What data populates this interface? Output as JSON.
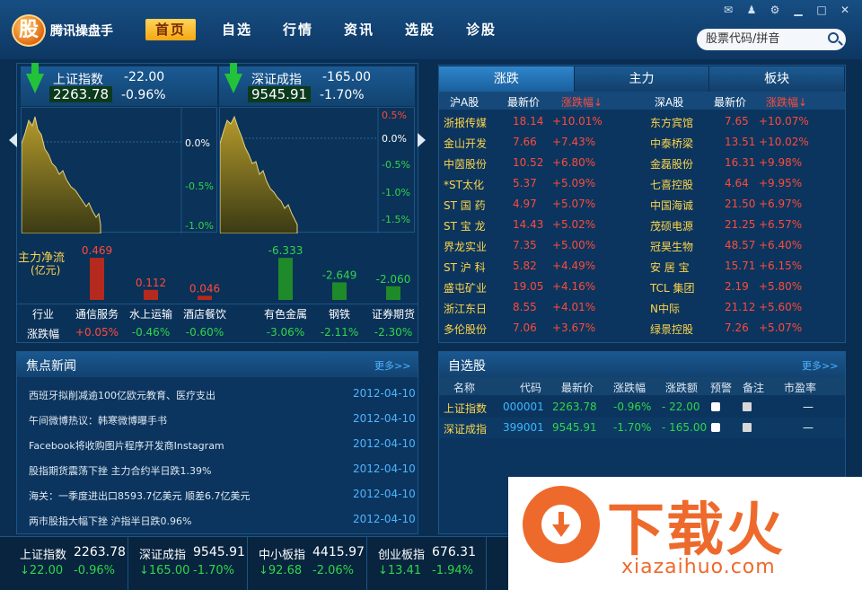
{
  "app": {
    "logo_char": "股",
    "name": "腾讯操盘手"
  },
  "nav": [
    "首页",
    "自选",
    "行情",
    "资讯",
    "选股",
    "诊股"
  ],
  "search": {
    "placeholder": "股票代码/拼音"
  },
  "indices": [
    {
      "name": "上证指数",
      "change": "-22.00",
      "value": "2263.78",
      "pct": "-0.96%",
      "axis": [
        "0.0%",
        "-0.5%",
        "-1.0%"
      ]
    },
    {
      "name": "深证成指",
      "change": "-165.00",
      "value": "9545.91",
      "pct": "-1.70%",
      "axis": [
        "0.5%",
        "0.0%",
        "-0.5%",
        "-1.0%",
        "-1.5%"
      ]
    }
  ],
  "fund_flow": {
    "title": "主力净流",
    "unit": "(亿元)",
    "row_labels": [
      "行业",
      "涨跌幅"
    ],
    "items": [
      {
        "industry": "通信服务",
        "value": "0.469",
        "change": "+0.05%",
        "amount": 0.469
      },
      {
        "industry": "水上运输",
        "value": "0.112",
        "change": "-0.46%",
        "amount": 0.112
      },
      {
        "industry": "酒店餐饮",
        "value": "0.046",
        "change": "-0.60%",
        "amount": 0.046
      },
      {
        "industry": "有色金属",
        "value": "-6.333",
        "change": "-3.06%",
        "amount": -6.333
      },
      {
        "industry": "钢铁",
        "value": "-2.649",
        "change": "-2.11%",
        "amount": -2.649
      },
      {
        "industry": "证券期货",
        "value": "-2.060",
        "change": "-2.30%",
        "amount": -2.06
      }
    ]
  },
  "rank_tabs": [
    "涨跌",
    "主力",
    "板块"
  ],
  "rank_header": {
    "sh": "沪A股",
    "price": "最新价",
    "pct": "涨跌幅↓",
    "sz": "深A股"
  },
  "sh_rank": [
    {
      "name": "浙报传媒",
      "price": "18.14",
      "pct": "+10.01%"
    },
    {
      "name": "金山开发",
      "price": "7.66",
      "pct": "+7.43%"
    },
    {
      "name": "中茵股份",
      "price": "10.52",
      "pct": "+6.80%"
    },
    {
      "name": "*ST太化",
      "price": "5.37",
      "pct": "+5.09%"
    },
    {
      "name": "ST 国 药",
      "price": "4.97",
      "pct": "+5.07%"
    },
    {
      "name": "ST 宝 龙",
      "price": "14.43",
      "pct": "+5.02%"
    },
    {
      "name": "界龙实业",
      "price": "7.35",
      "pct": "+5.00%"
    },
    {
      "name": "ST 沪 科",
      "price": "5.82",
      "pct": "+4.49%"
    },
    {
      "name": "盛屯矿业",
      "price": "19.05",
      "pct": "+4.16%"
    },
    {
      "name": "浙江东日",
      "price": "8.55",
      "pct": "+4.01%"
    },
    {
      "name": "多伦股份",
      "price": "7.06",
      "pct": "+3.67%"
    }
  ],
  "sz_rank": [
    {
      "name": "东方宾馆",
      "price": "7.65",
      "pct": "+10.07%"
    },
    {
      "name": "中泰桥梁",
      "price": "13.51",
      "pct": "+10.02%"
    },
    {
      "name": "金磊股份",
      "price": "16.31",
      "pct": "+9.98%"
    },
    {
      "name": "七喜控股",
      "price": "4.64",
      "pct": "+9.95%"
    },
    {
      "name": "中国海诚",
      "price": "21.50",
      "pct": "+6.97%"
    },
    {
      "name": "茂硕电源",
      "price": "21.25",
      "pct": "+6.57%"
    },
    {
      "name": "冠昊生物",
      "price": "48.57",
      "pct": "+6.40%"
    },
    {
      "name": "安 居 宝",
      "price": "15.71",
      "pct": "+6.15%"
    },
    {
      "name": "TCL 集团",
      "price": "2.19",
      "pct": "+5.80%"
    },
    {
      "name": "N中际",
      "price": "21.12",
      "pct": "+5.60%"
    },
    {
      "name": "绿景控股",
      "price": "7.26",
      "pct": "+5.07%"
    }
  ],
  "news": {
    "title": "焦点新闻",
    "more": "更多>>",
    "items": [
      {
        "title": "西班牙拟削减逾100亿欧元教育、医疗支出",
        "date": "2012-04-10"
      },
      {
        "title": "午间微博热议：韩寒微博曝手书",
        "date": "2012-04-10"
      },
      {
        "title": "Facebook将收购图片程序开发商Instagram",
        "date": "2012-04-10"
      },
      {
        "title": "股指期货震荡下挫 主力合约半日跌1.39%",
        "date": "2012-04-10"
      },
      {
        "title": "海关：一季度进出口8593.7亿美元 顺差6.7亿美元",
        "date": "2012-04-10"
      },
      {
        "title": "两市股指大幅下挫 沪指半日跌0.96%",
        "date": "2012-04-10"
      }
    ]
  },
  "watchlist": {
    "title": "自选股",
    "more": "更多>>",
    "headers": [
      "名称",
      "代码",
      "最新价",
      "涨跌幅",
      "涨跌额",
      "预警",
      "备注",
      "市盈率"
    ],
    "rows": [
      {
        "name": "上证指数",
        "code": "000001",
        "price": "2263.78",
        "pct": "-0.96%",
        "chg": "- 22.00",
        "pe": "—"
      },
      {
        "name": "深证成指",
        "code": "399001",
        "price": "9545.91",
        "pct": "-1.70%",
        "chg": "- 165.00",
        "pe": "—"
      }
    ]
  },
  "ticker": [
    {
      "name": "上证指数",
      "value": "2263.78",
      "delta": "↓22.00",
      "pct": "-0.96%"
    },
    {
      "name": "深证成指",
      "value": "9545.91",
      "delta": "↓165.00",
      "pct": "-1.70%"
    },
    {
      "name": "中小板指",
      "value": "4415.97",
      "delta": "↓92.68",
      "pct": "-2.06%"
    },
    {
      "name": "创业板指",
      "value": "676.31",
      "delta": "↓13.41",
      "pct": "-1.94%"
    }
  ],
  "watermark": {
    "big": "下载火",
    "small": "xiazaihuo.com"
  },
  "colors": {
    "up": "#ff4a3a",
    "down": "#2fd64a",
    "accent": "#f3a812",
    "link": "#4fb4ff"
  }
}
